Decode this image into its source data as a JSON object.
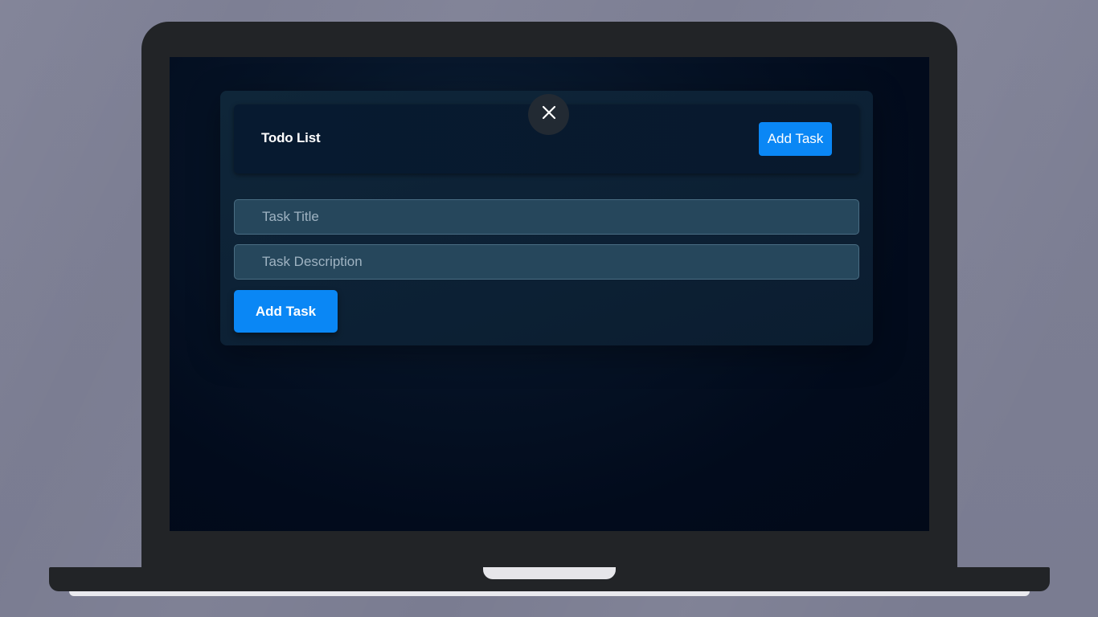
{
  "app": {
    "header_title": "Todo List",
    "header_add_label": "Add Task",
    "close_icon": "close-icon"
  },
  "form": {
    "title_placeholder": "Task Title",
    "title_value": "",
    "description_placeholder": "Task Description",
    "description_value": "",
    "submit_label": "Add Task"
  },
  "colors": {
    "accent": "#0a87f5",
    "background": "#7b7d92",
    "device": "#222427",
    "screen": "#020b1c"
  }
}
